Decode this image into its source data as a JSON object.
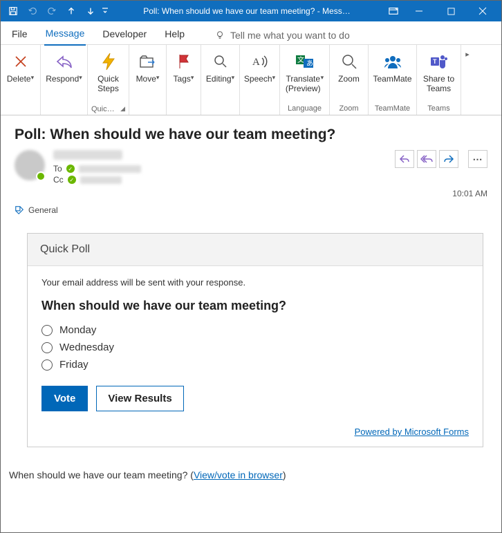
{
  "titlebar": {
    "title": "Poll: When should we have our team meeting?  -  Mess…"
  },
  "menu": {
    "file": "File",
    "message": "Message",
    "developer": "Developer",
    "help": "Help",
    "tellme": "Tell me what you want to do"
  },
  "ribbon": {
    "delete": "Delete",
    "respond": "Respond",
    "quicksteps": "Quick\nSteps",
    "quicksteps_group": "Quic…",
    "move": "Move",
    "tags": "Tags",
    "editing": "Editing",
    "speech": "Speech",
    "translate": "Translate\n(Preview)",
    "language_group": "Language",
    "zoom": "Zoom",
    "zoom_group": "Zoom",
    "teammate": "TeamMate",
    "teammate_group": "TeamMate",
    "sharetoteams": "Share to\nTeams",
    "teams_group": "Teams"
  },
  "reading": {
    "subject": "Poll: When should we have our team meeting?",
    "to_label": "To",
    "cc_label": "Cc",
    "time": "10:01 AM",
    "category": "General"
  },
  "poll": {
    "card_title": "Quick Poll",
    "disclaimer": "Your email address will be sent with your response.",
    "question": "When should we have our team meeting?",
    "options": [
      "Monday",
      "Wednesday",
      "Friday"
    ],
    "vote": "Vote",
    "view_results": "View Results",
    "powered": "Powered by Microsoft Forms"
  },
  "footer": {
    "text": "When should we have our team meeting? (",
    "link": "View/vote in browser",
    "after": ")"
  }
}
